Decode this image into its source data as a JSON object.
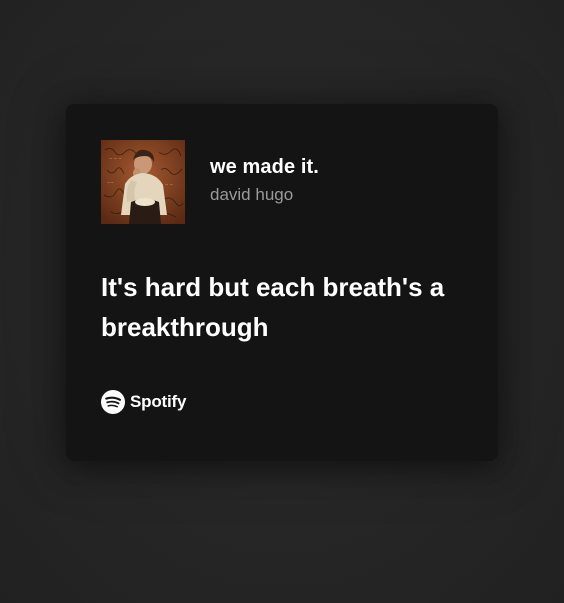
{
  "track": {
    "title": "we made it.",
    "artist": "david hugo"
  },
  "lyric": "It's hard but each breath's a breakthrough",
  "brand": {
    "name": "Spotify",
    "logo": "spotify-logo-icon"
  },
  "cover": {
    "icon": "album-cover",
    "dominant_color": "#7a3a1d"
  },
  "colors": {
    "page_background": "#262626",
    "card_background": "#141414",
    "title": "#ffffff",
    "artist": "#9a9a9a"
  }
}
